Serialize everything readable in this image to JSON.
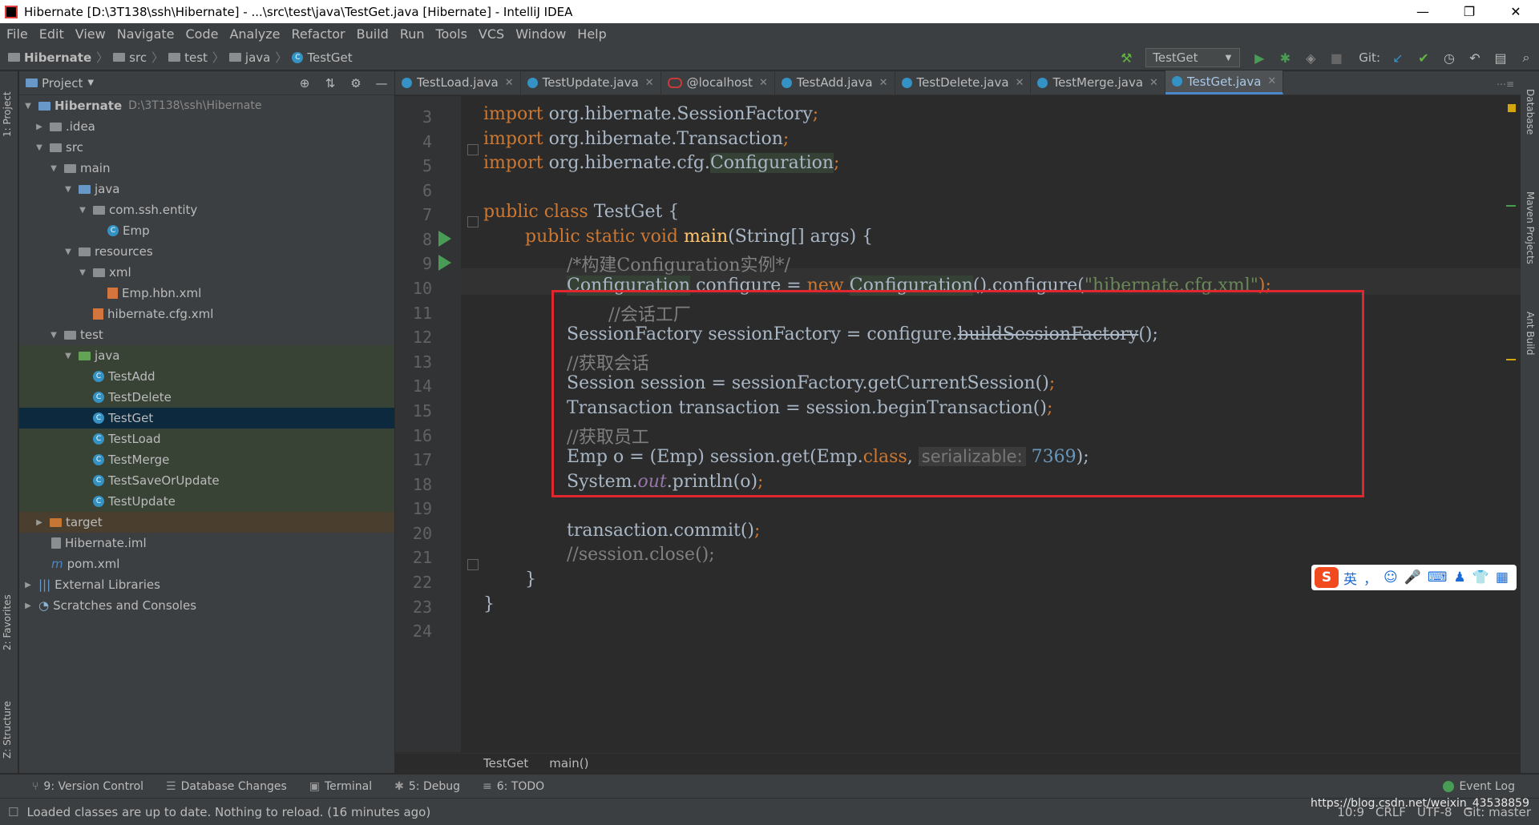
{
  "window": {
    "title": "Hibernate [D:\\3T138\\ssh\\Hibernate] - ...\\src\\test\\java\\TestGet.java [Hibernate] - IntelliJ IDEA",
    "controls": [
      "—",
      "❐",
      "✕"
    ]
  },
  "menu": [
    "File",
    "Edit",
    "View",
    "Navigate",
    "Code",
    "Analyze",
    "Refactor",
    "Build",
    "Run",
    "Tools",
    "VCS",
    "Window",
    "Help"
  ],
  "breadcrumb": [
    "Hibernate",
    "src",
    "test",
    "java",
    "TestGet"
  ],
  "run_config": "TestGet",
  "git_label": "Git:",
  "project_panel": {
    "title": "Project",
    "root": "Hibernate",
    "root_path": "D:\\3T138\\ssh\\Hibernate",
    "items": [
      {
        "label": "Hibernate",
        "extra": "D:\\3T138\\ssh\\Hibernate"
      },
      {
        "label": ".idea"
      },
      {
        "label": "src"
      },
      {
        "label": "main"
      },
      {
        "label": "java"
      },
      {
        "label": "com.ssh.entity"
      },
      {
        "label": "Emp"
      },
      {
        "label": "resources"
      },
      {
        "label": "xml"
      },
      {
        "label": "Emp.hbn.xml"
      },
      {
        "label": "hibernate.cfg.xml"
      },
      {
        "label": "test"
      },
      {
        "label": "java"
      },
      {
        "label": "TestAdd"
      },
      {
        "label": "TestDelete"
      },
      {
        "label": "TestGet"
      },
      {
        "label": "TestLoad"
      },
      {
        "label": "TestMerge"
      },
      {
        "label": "TestSaveOrUpdate"
      },
      {
        "label": "TestUpdate"
      },
      {
        "label": "target"
      },
      {
        "label": "Hibernate.iml"
      },
      {
        "label": "pom.xml"
      },
      {
        "label": "External Libraries"
      },
      {
        "label": "Scratches and Consoles"
      }
    ]
  },
  "left_strip": {
    "project": "1: Project",
    "favorites": "2: Favorites",
    "structure": "Z: Structure"
  },
  "right_strip": {
    "database": "Database",
    "maven": "Maven Projects",
    "ant": "Ant Build"
  },
  "tabs": [
    {
      "label": "TestLoad.java"
    },
    {
      "label": "TestUpdate.java"
    },
    {
      "label": "@localhost"
    },
    {
      "label": "TestAdd.java"
    },
    {
      "label": "TestDelete.java"
    },
    {
      "label": "TestMerge.java"
    },
    {
      "label": "TestGet.java"
    }
  ],
  "line_numbers": [
    "3",
    "4",
    "5",
    "6",
    "7",
    "8",
    "9",
    "10",
    "11",
    "12",
    "13",
    "14",
    "15",
    "16",
    "17",
    "18",
    "19",
    "20",
    "21",
    "22",
    "23",
    "24"
  ],
  "code": {
    "l3a": "import",
    "l3b": " org.hibernate.SessionFactory",
    "l3c": ";",
    "l4a": "import",
    "l4b": " org.hibernate.Transaction",
    "l4c": ";",
    "l5a": "import",
    "l5b": " org.hibernate.cfg.",
    "l5c": "Configuration",
    "l5d": ";",
    "l7a": "public class",
    "l7b": " TestGet {",
    "l8a": "public static void",
    "l8b": "main",
    "l8c": "(String[] args) {",
    "l9": "/*构建Configuration实例*/",
    "l10a": "Configuration",
    "l10b": " configure = ",
    "l10c": "new",
    "l10d": "Configuration",
    "l10e": "().configure(",
    "l10f": "\"hibernate.cfg.xml\"",
    "l10g": ");",
    "l11": "//会话工厂",
    "l12a": "SessionFactory sessionFactory = configure.",
    "l12b": "buildSessionFactory",
    "l12c": "();",
    "l13": "//获取会话",
    "l14a": "Session session = sessionFactory.getCurrentSession()",
    "l14b": ";",
    "l15a": "Transaction transaction = session.beginTransaction()",
    "l15b": ";",
    "l16": "//获取员工",
    "l17a": "Emp o = (Emp) session.get(Emp.",
    "l17b": "class",
    "l17c": ", ",
    "l17d": "serializable:",
    "l17e": "7369",
    "l17f": ");",
    "l18a": "System.",
    "l18b": "out",
    "l18c": ".println(o)",
    "l18d": ";",
    "l20a": "transaction.commit()",
    "l20b": ";",
    "l21": "//session.close();",
    "l22": "}",
    "l23": "}"
  },
  "editor_breadcrumb": [
    "TestGet",
    "main()"
  ],
  "bottom_tools": [
    {
      "label": "9: Version Control"
    },
    {
      "label": "Database Changes"
    },
    {
      "label": "Terminal"
    },
    {
      "label": "5: Debug"
    },
    {
      "label": "6: TODO"
    }
  ],
  "event_log": "Event Log",
  "status": {
    "message": "Loaded classes are up to date. Nothing to reload. (16 minutes ago)",
    "position": "10:9",
    "line_sep": "CRLF",
    "encoding": "UTF-8",
    "vcs": "Git: master",
    "watermark": "https://blog.csdn.net/weixin_43538859"
  },
  "ime": {
    "lang": "英",
    "punct": "，"
  },
  "colors": {
    "accent": "#4a88c7",
    "highlight_box": "#e0262e",
    "run_green": "#499c54"
  }
}
